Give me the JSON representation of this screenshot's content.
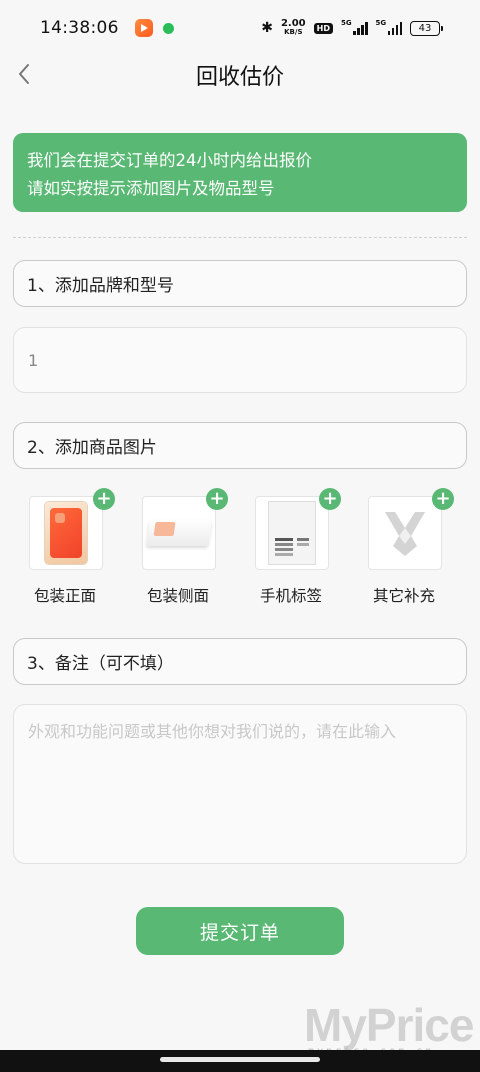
{
  "status_bar": {
    "time": "14:38:06",
    "speed_value": "2.00",
    "speed_unit": "KB/S",
    "hd_label": "HD",
    "signal1_label": "5G",
    "signal2_label": "5G",
    "battery": "43"
  },
  "header": {
    "title": "回收估价"
  },
  "notice": {
    "line1": "我们会在提交订单的24小时内给出报价",
    "line2": "请如实按提示添加图片及物品型号"
  },
  "brand_section": {
    "label": "1、添加品牌和型号",
    "input_value": "1"
  },
  "photo_section": {
    "label": "2、添加商品图片",
    "items": [
      {
        "label": "包装正面",
        "add": "+"
      },
      {
        "label": "包装侧面",
        "add": "+"
      },
      {
        "label": "手机标签",
        "add": "+"
      },
      {
        "label": "其它补充",
        "add": "+"
      }
    ]
  },
  "note_section": {
    "label": "3、备注（可不填）",
    "placeholder": "外观和功能问题或其他你想对我们说的，请在此输入"
  },
  "submit": {
    "label": "提交订单"
  },
  "watermark": {
    "brand": "MyPrice",
    "url": "myprice.com.cn"
  },
  "colors": {
    "accent": "#59b873",
    "background": "#f7f7f7"
  }
}
